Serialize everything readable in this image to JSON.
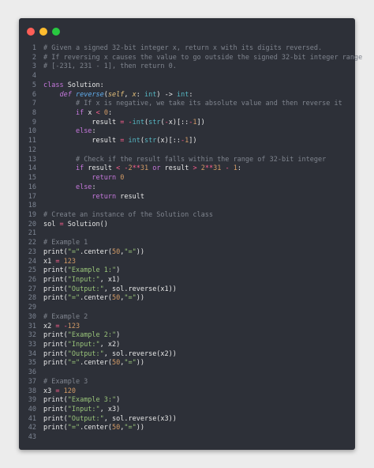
{
  "window": {
    "buttons": [
      {
        "name": "close",
        "color": "#ff5f57"
      },
      {
        "name": "minimize",
        "color": "#febc2e"
      },
      {
        "name": "maximize",
        "color": "#28c840"
      }
    ]
  },
  "colors": {
    "keyword": "#c678dd",
    "function": "#61afef",
    "builtin": "#56b6c2",
    "comment": "#7f848e",
    "number": "#d19a66",
    "string": "#98c379",
    "operator": "#ff5f8f",
    "self": "#e5c07b",
    "text": "#e8e8e8"
  },
  "code_lines": [
    [
      [
        "c",
        "# Given a signed 32-bit integer x, return x with its digits reversed."
      ]
    ],
    [
      [
        "c",
        "# If reversing x causes the value to go outside the signed 32-bit integer range"
      ]
    ],
    [
      [
        "c",
        "# [-231, 231 - 1], then return 0."
      ]
    ],
    [],
    [
      [
        "k",
        "class"
      ],
      [
        "p",
        " Solution:"
      ]
    ],
    [
      [
        "p",
        "    "
      ],
      [
        "kw",
        "def"
      ],
      [
        "p",
        " "
      ],
      [
        "f",
        "reverse"
      ],
      [
        "p",
        "("
      ],
      [
        "sf",
        "self"
      ],
      [
        "p",
        ", "
      ],
      [
        "sf",
        "x"
      ],
      [
        "p",
        ": "
      ],
      [
        "b",
        "int"
      ],
      [
        "p",
        ") -> "
      ],
      [
        "b",
        "int"
      ],
      [
        "p",
        ":"
      ]
    ],
    [
      [
        "p",
        "        "
      ],
      [
        "c",
        "# If x is negative, we take its absolute value and then reverse it"
      ]
    ],
    [
      [
        "p",
        "        "
      ],
      [
        "k",
        "if"
      ],
      [
        "p",
        " x "
      ],
      [
        "o",
        "<"
      ],
      [
        "p",
        " "
      ],
      [
        "n",
        "0"
      ],
      [
        "p",
        ":"
      ]
    ],
    [
      [
        "p",
        "            result "
      ],
      [
        "o",
        "="
      ],
      [
        "p",
        " "
      ],
      [
        "o",
        "-"
      ],
      [
        "b",
        "int"
      ],
      [
        "p",
        "("
      ],
      [
        "b",
        "str"
      ],
      [
        "p",
        "("
      ],
      [
        "o",
        "-"
      ],
      [
        "p",
        "x)[::"
      ],
      [
        "o",
        "-"
      ],
      [
        "n",
        "1"
      ],
      [
        "p",
        "])"
      ]
    ],
    [
      [
        "p",
        "        "
      ],
      [
        "k",
        "else"
      ],
      [
        "p",
        ":"
      ]
    ],
    [
      [
        "p",
        "            result "
      ],
      [
        "o",
        "="
      ],
      [
        "p",
        " "
      ],
      [
        "b",
        "int"
      ],
      [
        "p",
        "("
      ],
      [
        "b",
        "str"
      ],
      [
        "p",
        "(x)[::"
      ],
      [
        "o",
        "-"
      ],
      [
        "n",
        "1"
      ],
      [
        "p",
        "])"
      ]
    ],
    [],
    [
      [
        "p",
        "        "
      ],
      [
        "c",
        "# Check if the result falls within the range of 32-bit integer"
      ]
    ],
    [
      [
        "p",
        "        "
      ],
      [
        "k",
        "if"
      ],
      [
        "p",
        " result "
      ],
      [
        "o",
        "<"
      ],
      [
        "p",
        " "
      ],
      [
        "o",
        "-"
      ],
      [
        "n",
        "2"
      ],
      [
        "o",
        "**"
      ],
      [
        "n",
        "31"
      ],
      [
        "p",
        " "
      ],
      [
        "k",
        "or"
      ],
      [
        "p",
        " result "
      ],
      [
        "o",
        ">"
      ],
      [
        "p",
        " "
      ],
      [
        "n",
        "2"
      ],
      [
        "o",
        "**"
      ],
      [
        "n",
        "31"
      ],
      [
        "p",
        " "
      ],
      [
        "o",
        "-"
      ],
      [
        "p",
        " "
      ],
      [
        "n",
        "1"
      ],
      [
        "p",
        ":"
      ]
    ],
    [
      [
        "p",
        "            "
      ],
      [
        "k",
        "return"
      ],
      [
        "p",
        " "
      ],
      [
        "n",
        "0"
      ]
    ],
    [
      [
        "p",
        "        "
      ],
      [
        "k",
        "else"
      ],
      [
        "p",
        ":"
      ]
    ],
    [
      [
        "p",
        "            "
      ],
      [
        "k",
        "return"
      ],
      [
        "p",
        " result"
      ]
    ],
    [],
    [
      [
        "c",
        "# Create an instance of the Solution class"
      ]
    ],
    [
      [
        "p",
        "sol "
      ],
      [
        "o",
        "="
      ],
      [
        "p",
        " Solution()"
      ]
    ],
    [],
    [
      [
        "c",
        "# Example 1"
      ]
    ],
    [
      [
        "p",
        "print("
      ],
      [
        "s",
        "\"=\""
      ],
      [
        "p",
        ".center("
      ],
      [
        "n",
        "50"
      ],
      [
        "p",
        ","
      ],
      [
        "s",
        "\"=\""
      ],
      [
        "p",
        "))"
      ]
    ],
    [
      [
        "p",
        "x1 "
      ],
      [
        "o",
        "="
      ],
      [
        "p",
        " "
      ],
      [
        "n",
        "123"
      ]
    ],
    [
      [
        "p",
        "print("
      ],
      [
        "s",
        "\"Example 1:\""
      ],
      [
        "p",
        ")"
      ]
    ],
    [
      [
        "p",
        "print("
      ],
      [
        "s",
        "\"Input:\""
      ],
      [
        "p",
        ", x1)"
      ]
    ],
    [
      [
        "p",
        "print("
      ],
      [
        "s",
        "\"Output:\""
      ],
      [
        "p",
        ", sol.reverse(x1))"
      ]
    ],
    [
      [
        "p",
        "print("
      ],
      [
        "s",
        "\"=\""
      ],
      [
        "p",
        ".center("
      ],
      [
        "n",
        "50"
      ],
      [
        "p",
        ","
      ],
      [
        "s",
        "\"=\""
      ],
      [
        "p",
        "))"
      ]
    ],
    [],
    [
      [
        "c",
        "# Example 2"
      ]
    ],
    [
      [
        "p",
        "x2 "
      ],
      [
        "o",
        "="
      ],
      [
        "p",
        " "
      ],
      [
        "o",
        "-"
      ],
      [
        "n",
        "123"
      ]
    ],
    [
      [
        "p",
        "print("
      ],
      [
        "s",
        "\"Example 2:\""
      ],
      [
        "p",
        ")"
      ]
    ],
    [
      [
        "p",
        "print("
      ],
      [
        "s",
        "\"Input:\""
      ],
      [
        "p",
        ", x2)"
      ]
    ],
    [
      [
        "p",
        "print("
      ],
      [
        "s",
        "\"Output:\""
      ],
      [
        "p",
        ", sol.reverse(x2))"
      ]
    ],
    [
      [
        "p",
        "print("
      ],
      [
        "s",
        "\"=\""
      ],
      [
        "p",
        ".center("
      ],
      [
        "n",
        "50"
      ],
      [
        "p",
        ","
      ],
      [
        "s",
        "\"=\""
      ],
      [
        "p",
        "))"
      ]
    ],
    [],
    [
      [
        "c",
        "# Example 3"
      ]
    ],
    [
      [
        "p",
        "x3 "
      ],
      [
        "o",
        "="
      ],
      [
        "p",
        " "
      ],
      [
        "n",
        "120"
      ]
    ],
    [
      [
        "p",
        "print("
      ],
      [
        "s",
        "\"Example 3:\""
      ],
      [
        "p",
        ")"
      ]
    ],
    [
      [
        "p",
        "print("
      ],
      [
        "s",
        "\"Input:\""
      ],
      [
        "p",
        ", x3)"
      ]
    ],
    [
      [
        "p",
        "print("
      ],
      [
        "s",
        "\"Output:\""
      ],
      [
        "p",
        ", sol.reverse(x3))"
      ]
    ],
    [
      [
        "p",
        "print("
      ],
      [
        "s",
        "\"=\""
      ],
      [
        "p",
        ".center("
      ],
      [
        "n",
        "50"
      ],
      [
        "p",
        ","
      ],
      [
        "s",
        "\"=\""
      ],
      [
        "p",
        "))"
      ]
    ],
    []
  ]
}
